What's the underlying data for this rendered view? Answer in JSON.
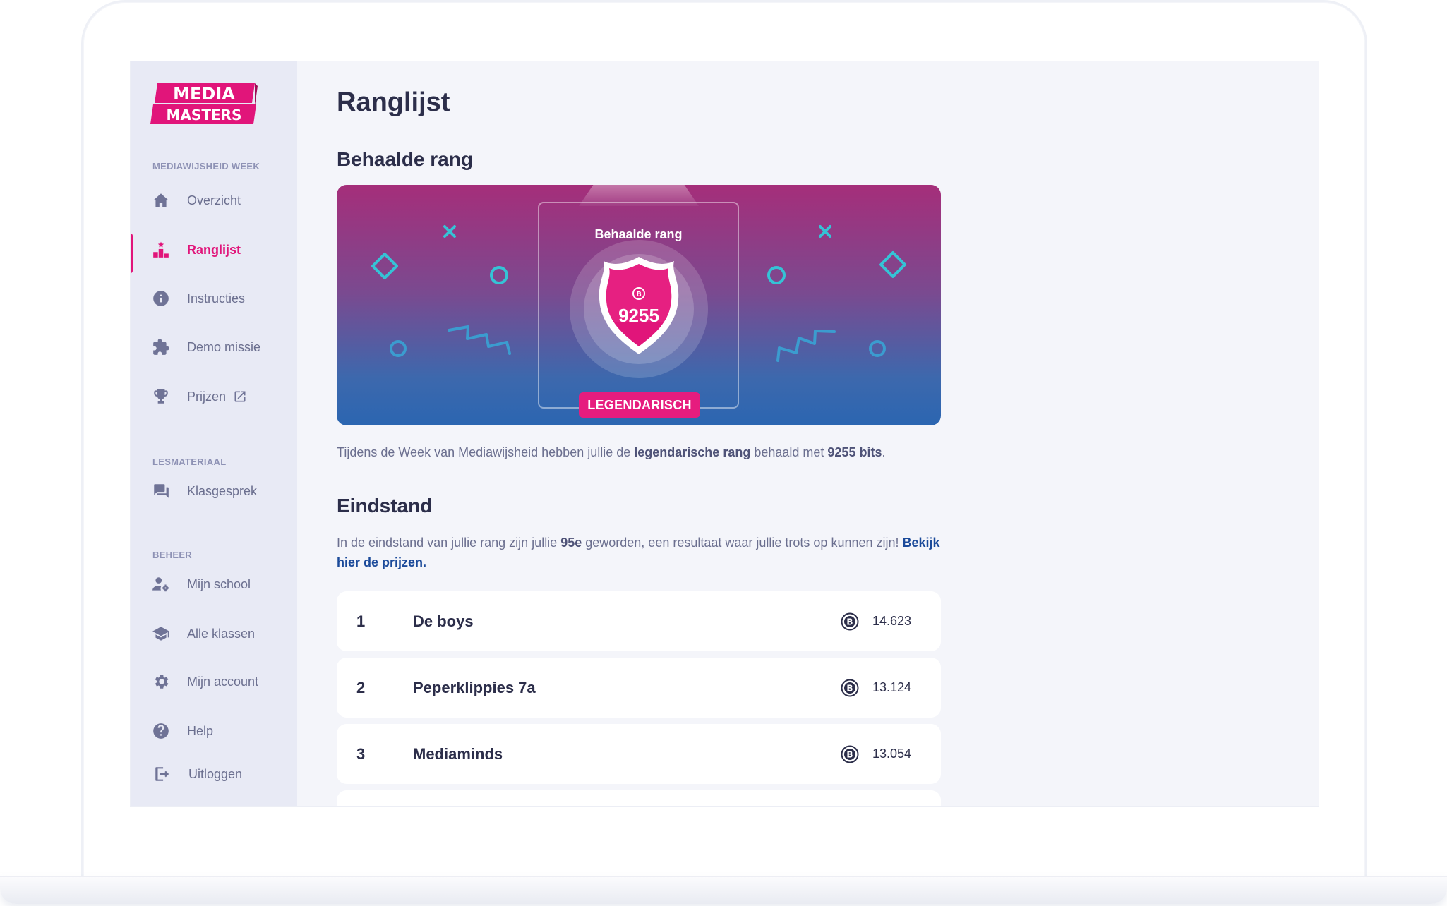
{
  "brand": {
    "line1": "MEDIA",
    "line2": "MASTERS",
    "color": "#e1157a"
  },
  "sidebar": {
    "sections": [
      {
        "label": "MEDIAWIJSHEID WEEK"
      },
      {
        "label": "LESMATERIAAL"
      },
      {
        "label": "BEHEER"
      }
    ],
    "items": [
      {
        "label": "Overzicht",
        "icon": "home-icon"
      },
      {
        "label": "Ranglijst",
        "icon": "podium-icon",
        "active": true
      },
      {
        "label": "Instructies",
        "icon": "info-icon"
      },
      {
        "label": "Demo missie",
        "icon": "puzzle-icon"
      },
      {
        "label": "Prijzen",
        "icon": "trophy-icon",
        "external": true
      },
      {
        "label": "Klasgesprek",
        "icon": "chat-icon"
      },
      {
        "label": "Mijn school",
        "icon": "user-gear-icon"
      },
      {
        "label": "Alle klassen",
        "icon": "graduation-cap-icon"
      },
      {
        "label": "Mijn account",
        "icon": "gear-icon"
      },
      {
        "label": "Help",
        "icon": "help-icon"
      },
      {
        "label": "Uitloggen",
        "icon": "logout-icon"
      }
    ]
  },
  "main": {
    "title": "Ranglijst",
    "rank_section_title": "Behaalde rang",
    "rank_card": {
      "box_title": "Behaalde rang",
      "bits": "9255",
      "rank_name": "LEGENDARISCH"
    },
    "rank_text": {
      "prefix": "Tijdens de Week van Mediawijsheid hebben jullie de ",
      "rank_bold": "legendarische rang",
      "middle": " behaald met ",
      "bits_bold": "9255 bits",
      "suffix": "."
    },
    "standings_title": "Eindstand",
    "standings_text": {
      "prefix": "In de eindstand van jullie rang zijn jullie ",
      "place_bold": "95e",
      "middle": " geworden, een resultaat waar jullie trots op kunnen zijn! ",
      "link": "Bekijk hier de prijzen."
    },
    "leaderboard": [
      {
        "rank": "1",
        "team": "De boys",
        "score": "14.623"
      },
      {
        "rank": "2",
        "team": "Peperklippies 7a",
        "score": "13.124"
      },
      {
        "rank": "3",
        "team": "Mediaminds",
        "score": "13.054"
      }
    ]
  },
  "colors": {
    "accent": "#e1157a",
    "link": "#1b4a9a",
    "card_top": "#a52e7a",
    "card_bottom": "#2b66b1",
    "confetti": "#35c3d6"
  }
}
